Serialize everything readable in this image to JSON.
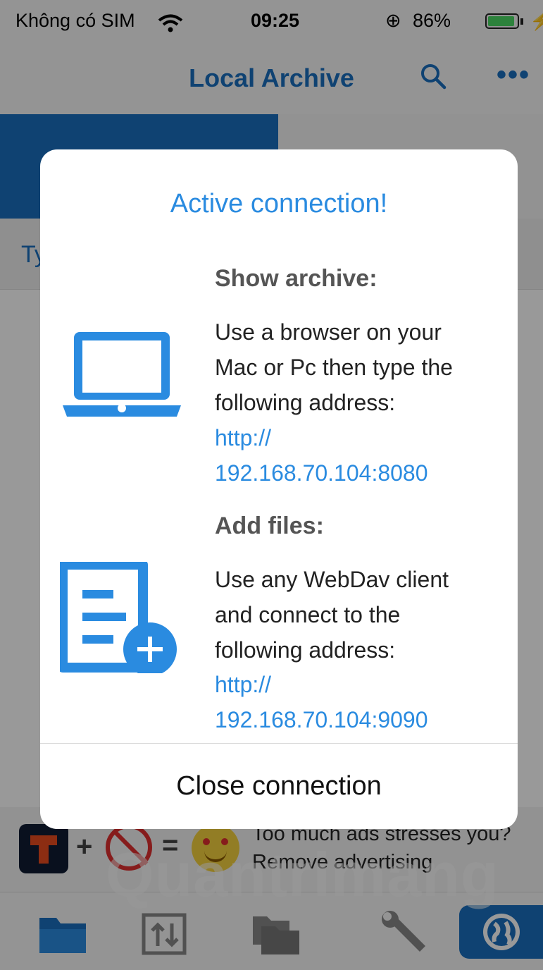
{
  "status_bar": {
    "carrier": "Không có SIM",
    "time": "09:25",
    "alarm_glyph": "⊕",
    "battery_percent": "86%",
    "battery_level": 0.86,
    "charging_glyph": "⚡"
  },
  "navbar": {
    "title": "Local Archive",
    "more_glyph": "•••"
  },
  "filter": {
    "label": "Ty"
  },
  "ad": {
    "plus": "+",
    "equals": "=",
    "line1": "Too much ads stresses you?",
    "line2": "Remove advertising"
  },
  "watermark": "Quantrimang",
  "dialog": {
    "title": "Active connection!",
    "show_archive": {
      "heading": "Show archive:",
      "body_lines": [
        "Use a browser on your",
        "Mac or Pc then type the",
        "following address:"
      ],
      "address_lines": [
        "http://",
        "192.168.70.104:8080"
      ]
    },
    "add_files": {
      "heading": "Add files:",
      "body_lines": [
        "Use any WebDav client",
        "and connect to the",
        "following address:"
      ],
      "address_lines": [
        "http://",
        "192.168.70.104:9090"
      ]
    },
    "close_label": "Close connection"
  },
  "icons": {
    "laptop": "laptop-icon",
    "add_document": "add-document-icon",
    "search": "search-icon"
  },
  "colors": {
    "accent": "#2a8be0",
    "nav_blue": "#1a6fbf",
    "battery_green": "#4cd964"
  }
}
